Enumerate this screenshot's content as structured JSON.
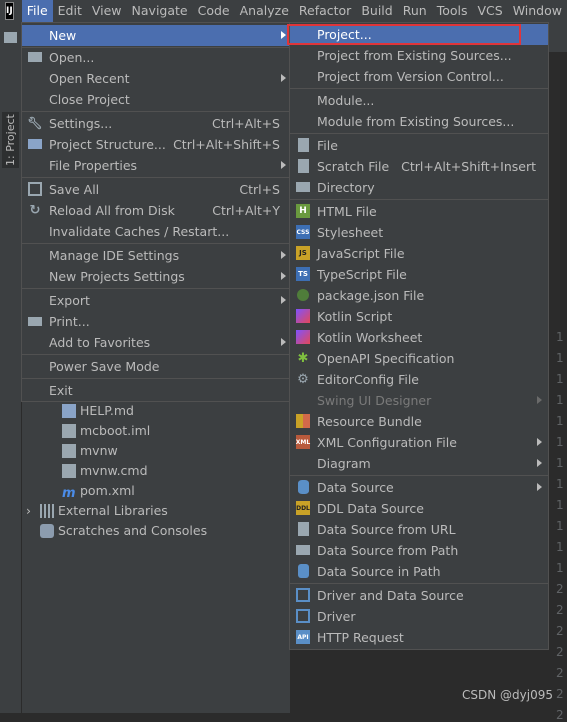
{
  "menubar": {
    "logo": "IJ",
    "items": [
      "File",
      "Edit",
      "View",
      "Navigate",
      "Code",
      "Analyze",
      "Refactor",
      "Build",
      "Run",
      "Tools",
      "VCS",
      "Window"
    ]
  },
  "side_panel": {
    "project_tab": "1: Project"
  },
  "project_tree": {
    "items": [
      {
        "label": "HELP.md"
      },
      {
        "label": "mcboot.iml"
      },
      {
        "label": "mvnw"
      },
      {
        "label": "mvnw.cmd"
      },
      {
        "label": "pom.xml"
      },
      {
        "label": "External Libraries"
      },
      {
        "label": "Scratches and Consoles"
      }
    ]
  },
  "gutter": {
    "numbers": [
      "1",
      "1",
      "1",
      "1",
      "1",
      "1",
      "1",
      "1",
      "1",
      "1",
      "1",
      "1",
      "2",
      "2",
      "2",
      "2",
      "2",
      "2",
      "2"
    ]
  },
  "file_menu": {
    "items": [
      {
        "label": "New",
        "shortcut": ""
      },
      {
        "label": "Open...",
        "shortcut": ""
      },
      {
        "label": "Open Recent",
        "shortcut": ""
      },
      {
        "label": "Close Project",
        "shortcut": ""
      },
      {
        "label": "Settings...",
        "shortcut": "Ctrl+Alt+S"
      },
      {
        "label": "Project Structure...",
        "shortcut": "Ctrl+Alt+Shift+S"
      },
      {
        "label": "File Properties",
        "shortcut": ""
      },
      {
        "label": "Save All",
        "shortcut": "Ctrl+S"
      },
      {
        "label": "Reload All from Disk",
        "shortcut": "Ctrl+Alt+Y"
      },
      {
        "label": "Invalidate Caches / Restart...",
        "shortcut": ""
      },
      {
        "label": "Manage IDE Settings",
        "shortcut": ""
      },
      {
        "label": "New Projects Settings",
        "shortcut": ""
      },
      {
        "label": "Export",
        "shortcut": ""
      },
      {
        "label": "Print...",
        "shortcut": ""
      },
      {
        "label": "Add to Favorites",
        "shortcut": ""
      },
      {
        "label": "Power Save Mode",
        "shortcut": ""
      },
      {
        "label": "Exit",
        "shortcut": ""
      }
    ]
  },
  "new_submenu": {
    "items": [
      {
        "label": "Project...",
        "shortcut": ""
      },
      {
        "label": "Project from Existing Sources...",
        "shortcut": ""
      },
      {
        "label": "Project from Version Control...",
        "shortcut": ""
      },
      {
        "label": "Module...",
        "shortcut": ""
      },
      {
        "label": "Module from Existing Sources...",
        "shortcut": ""
      },
      {
        "label": "File",
        "shortcut": ""
      },
      {
        "label": "Scratch File",
        "shortcut": "Ctrl+Alt+Shift+Insert"
      },
      {
        "label": "Directory",
        "shortcut": ""
      },
      {
        "label": "HTML File",
        "shortcut": ""
      },
      {
        "label": "Stylesheet",
        "shortcut": ""
      },
      {
        "label": "JavaScript File",
        "shortcut": ""
      },
      {
        "label": "TypeScript File",
        "shortcut": ""
      },
      {
        "label": "package.json File",
        "shortcut": ""
      },
      {
        "label": "Kotlin Script",
        "shortcut": ""
      },
      {
        "label": "Kotlin Worksheet",
        "shortcut": ""
      },
      {
        "label": "OpenAPI Specification",
        "shortcut": ""
      },
      {
        "label": "EditorConfig File",
        "shortcut": ""
      },
      {
        "label": "Swing UI Designer",
        "shortcut": ""
      },
      {
        "label": "Resource Bundle",
        "shortcut": ""
      },
      {
        "label": "XML Configuration File",
        "shortcut": ""
      },
      {
        "label": "Diagram",
        "shortcut": ""
      },
      {
        "label": "Data Source",
        "shortcut": ""
      },
      {
        "label": "DDL Data Source",
        "shortcut": ""
      },
      {
        "label": "Data Source from URL",
        "shortcut": ""
      },
      {
        "label": "Data Source from Path",
        "shortcut": ""
      },
      {
        "label": "Data Source in Path",
        "shortcut": ""
      },
      {
        "label": "Driver and Data Source",
        "shortcut": ""
      },
      {
        "label": "Driver",
        "shortcut": ""
      },
      {
        "label": "HTTP Request",
        "shortcut": ""
      }
    ]
  },
  "icon_text": {
    "html": "H",
    "css": "CSS",
    "js": "JS",
    "ts": "TS",
    "ddl": "DDL",
    "api": "API",
    "xml": "XML"
  },
  "watermark": "CSDN @dyj095",
  "colors": {
    "selection": "#4b6eaf",
    "menu_bg": "#3c3f41",
    "highlight_border": "#e0353a"
  }
}
